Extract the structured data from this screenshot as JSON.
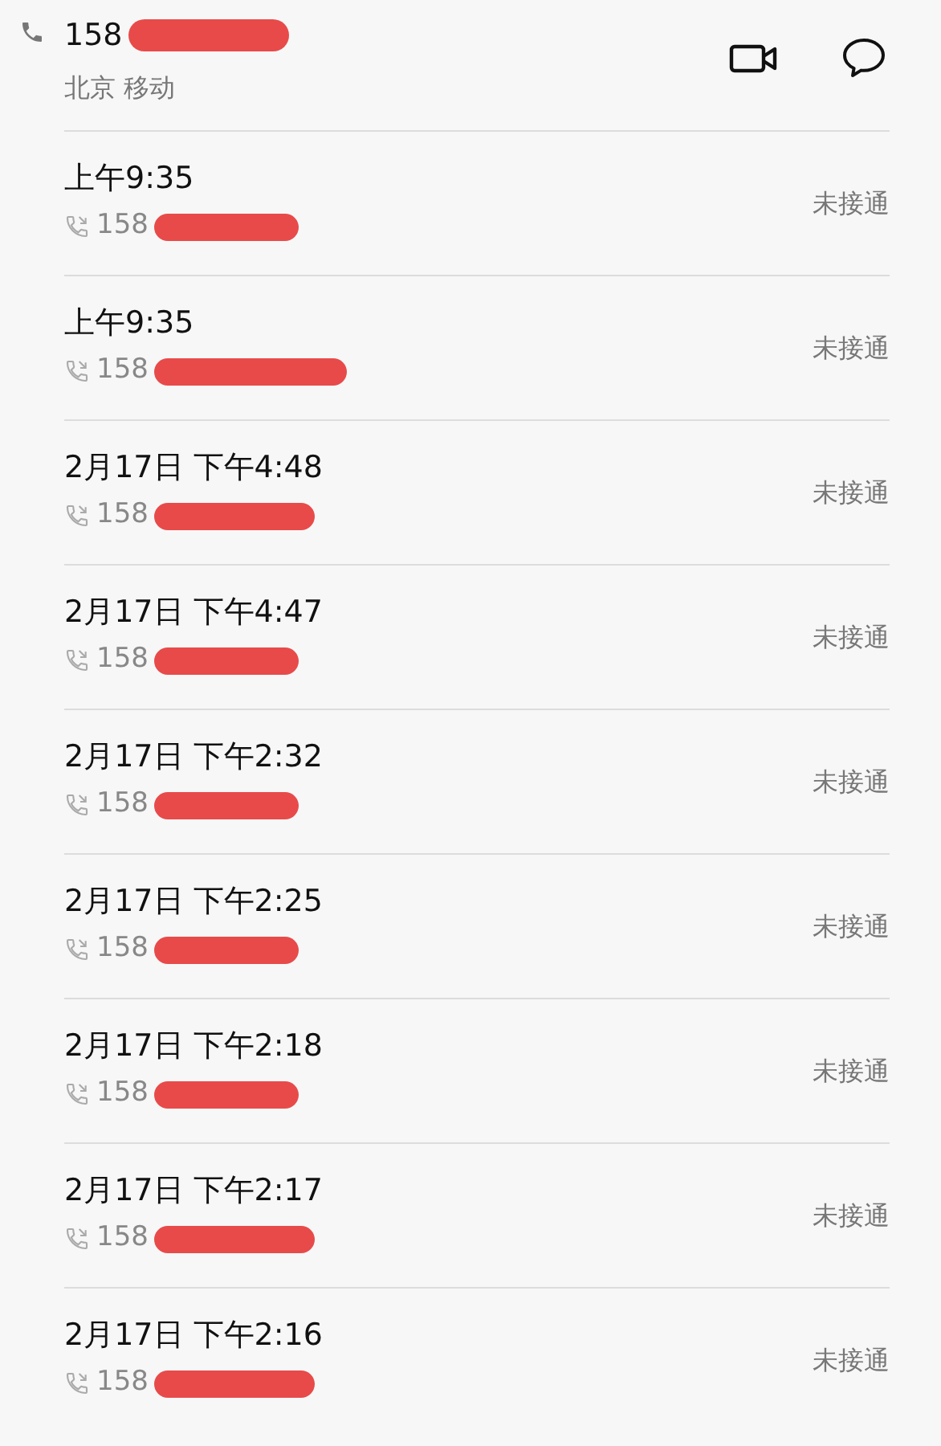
{
  "contact": {
    "number": "158",
    "location": "北京 移动"
  },
  "calls": [
    {
      "time": "上午9:35",
      "number": "158",
      "status": "未接通"
    },
    {
      "time": "上午9:35",
      "number": "158",
      "status": "未接通"
    },
    {
      "time": "2月17日 下午4:48",
      "number": "158",
      "status": "未接通"
    },
    {
      "time": "2月17日 下午4:47",
      "number": "158",
      "status": "未接通"
    },
    {
      "time": "2月17日 下午2:32",
      "number": "158",
      "status": "未接通"
    },
    {
      "time": "2月17日 下午2:25",
      "number": "158",
      "status": "未接通"
    },
    {
      "time": "2月17日 下午2:18",
      "number": "158",
      "status": "未接通"
    },
    {
      "time": "2月17日 下午2:17",
      "number": "158",
      "status": "未接通"
    },
    {
      "time": "2月17日 下午2:16",
      "number": "158",
      "status": "未接通"
    }
  ]
}
